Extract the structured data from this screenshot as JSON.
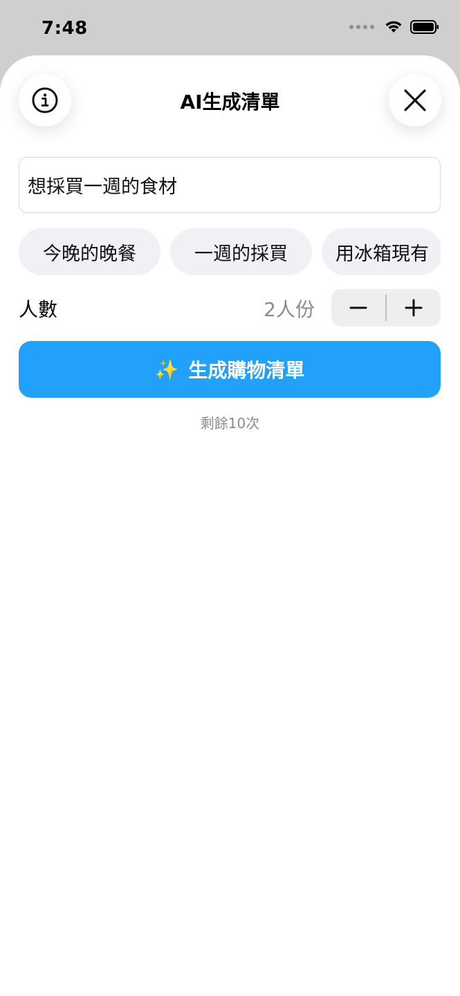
{
  "status_bar": {
    "time": "7:48"
  },
  "header": {
    "title": "AI生成清單",
    "info_icon": "info-circle-icon",
    "close_icon": "close-x-icon"
  },
  "prompt": {
    "value": "想採買一週的食材"
  },
  "suggestions": [
    "今晚的晚餐",
    "一週的採買",
    "用冰箱現有"
  ],
  "servings": {
    "label": "人數",
    "value": "2人份",
    "decrement_icon": "minus-icon",
    "increment_icon": "plus-icon"
  },
  "generate_button": {
    "icon": "✨",
    "label": "生成購物清單"
  },
  "remaining_text": "剩餘10次",
  "colors": {
    "accent": "#22a1fb",
    "chip_bg": "#f0f0f5",
    "secondary_text": "#8a8a8e"
  }
}
